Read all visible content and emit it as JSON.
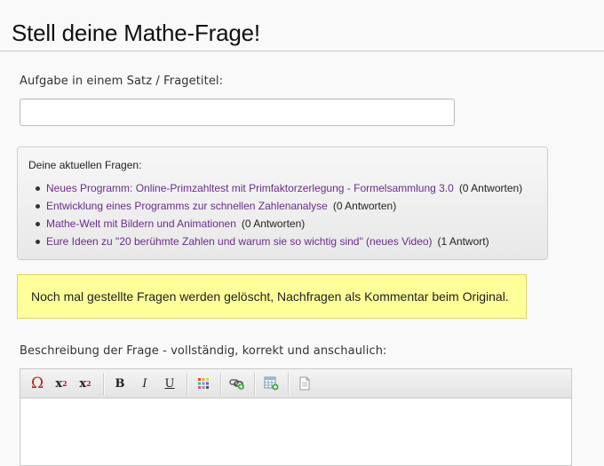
{
  "page": {
    "title": "Stell deine Mathe-Frage!"
  },
  "form": {
    "title_label": "Aufgabe in einem Satz / Fragetitel:",
    "title_value": "",
    "description_label": "Beschreibung der Frage - vollständig, korrekt und anschaulich:"
  },
  "current_questions": {
    "heading": "Deine aktuellen Fragen:",
    "items": [
      {
        "title": "Neues Programm: Online-Primzahltest mit Primfaktorzerlegung - Formelsammlung 3.0",
        "answers": "(0 Antworten)"
      },
      {
        "title": "Entwicklung eines Programms zur schnellen Zahlenanalyse",
        "answers": "(0 Antworten)"
      },
      {
        "title": "Mathe-Welt mit Bildern und Animationen",
        "answers": "(0 Antworten)"
      },
      {
        "title": "Eure Ideen zu \"20 berühmte Zahlen und warum sie so wichtig sind\" (neues Video)",
        "answers": "(1 Antwort)"
      }
    ]
  },
  "notice": {
    "text": "Noch mal gestellte Fragen werden gelöscht, Nachfragen als Kommentar beim Original."
  },
  "toolbar": {
    "omega": "Ω",
    "superscript_base": "x",
    "superscript_exp": "2",
    "subscript_base": "x",
    "subscript_idx": "2",
    "bold": "B",
    "italic": "I",
    "underline": "U"
  },
  "colors": {
    "link": "#6a2d8a",
    "notice_bg": "#ffff99",
    "notice_border": "#e2d060",
    "symbol_red": "#b22222"
  }
}
